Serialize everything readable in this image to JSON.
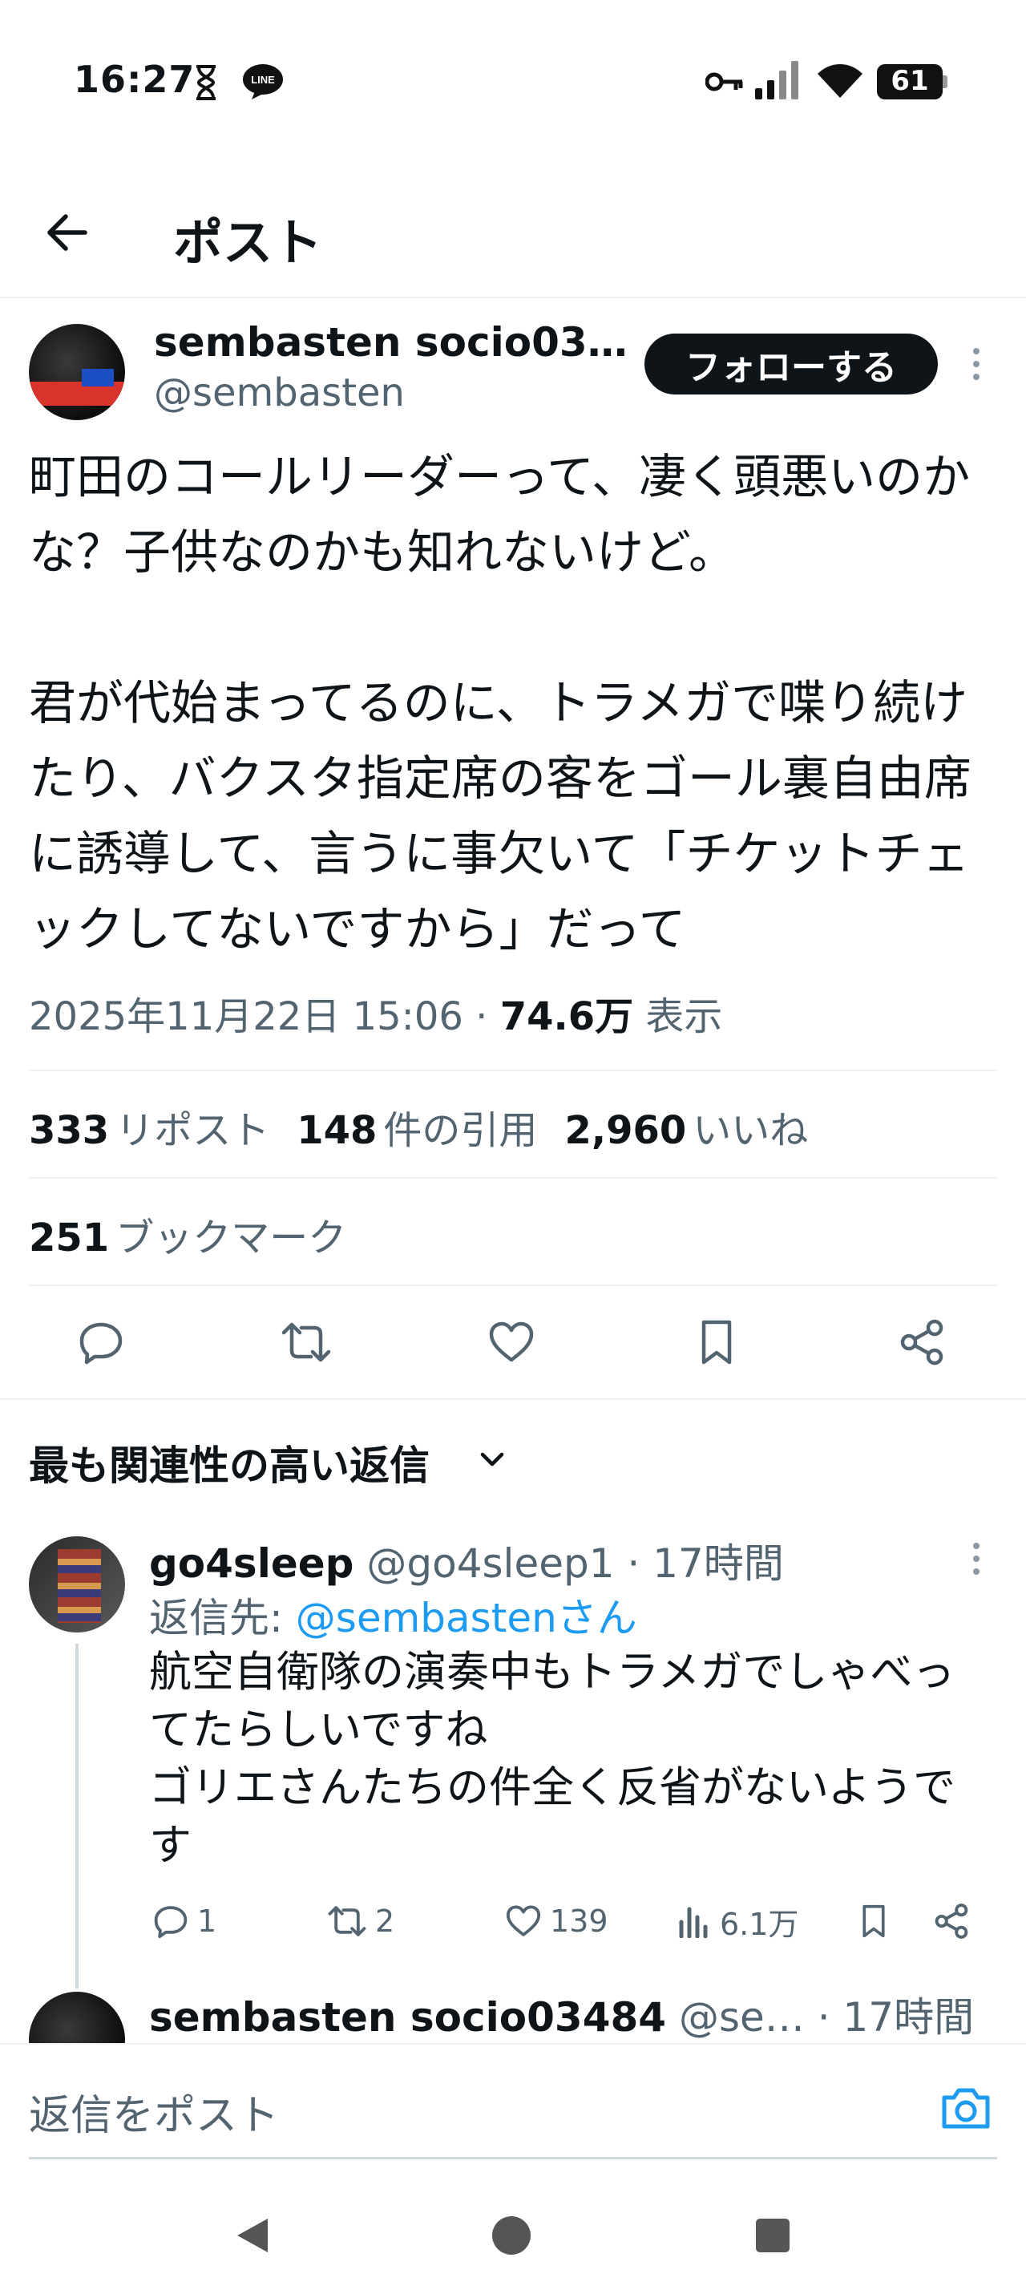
{
  "status_bar": {
    "time": "16:27",
    "battery": "61",
    "icons": [
      "hourglass-icon",
      "line-app-icon",
      "key-icon",
      "signal-icon",
      "wifi-icon",
      "battery-icon"
    ],
    "line_label": "LINE"
  },
  "header": {
    "title": "ポスト",
    "back_icon": "arrow-left-icon"
  },
  "post": {
    "author_name": "sembasten socio03…",
    "author_handle": "@sembasten",
    "follow_label": "フォローする",
    "text": "町田のコールリーダーって、凄く頭悪いのかな？子供なのかも知れないけど。\n\n君が代始まってるのに、トラメガで喋り続けたり、バクスタ指定席の客をゴール裏自由席に誘導して、言うに事欠いて「チケットチェックしてないですから」だって",
    "timestamp": "2025年11月22日 15:06",
    "separator": "·",
    "views": "74.6万",
    "views_label": "表示",
    "reposts": "333",
    "reposts_label": "リポスト",
    "quotes": "148",
    "quotes_label": "件の引用",
    "likes": "2,960",
    "likes_label": "いいね",
    "bookmarks": "251",
    "bookmarks_label": "ブックマーク"
  },
  "actions": [
    "reply-icon",
    "repost-icon",
    "like-icon",
    "bookmark-icon",
    "share-icon"
  ],
  "replies_sort": {
    "label": "最も関連性の高い返信",
    "icon": "chevron-down-icon"
  },
  "reply": {
    "name": "go4sleep",
    "handle": "@go4sleep1",
    "time": "· 17時間",
    "reply_to_label": "返信先:",
    "reply_to_user": "@sembastenさん",
    "text": "航空自衛隊の演奏中もトラメガでしゃべってたらしいですね\nゴリエさんたちの件全く反省がないようです",
    "reply_count": "1",
    "repost_count": "2",
    "like_count": "139",
    "view_count": "6.1万"
  },
  "reply2": {
    "name": "sembasten socio03484",
    "handle": "@se…",
    "time": "· 17時間"
  },
  "composer": {
    "placeholder": "返信をポスト",
    "icon": "camera-icon"
  },
  "nav": [
    "back-triangle-icon",
    "home-circle-icon",
    "recents-square-icon"
  ]
}
